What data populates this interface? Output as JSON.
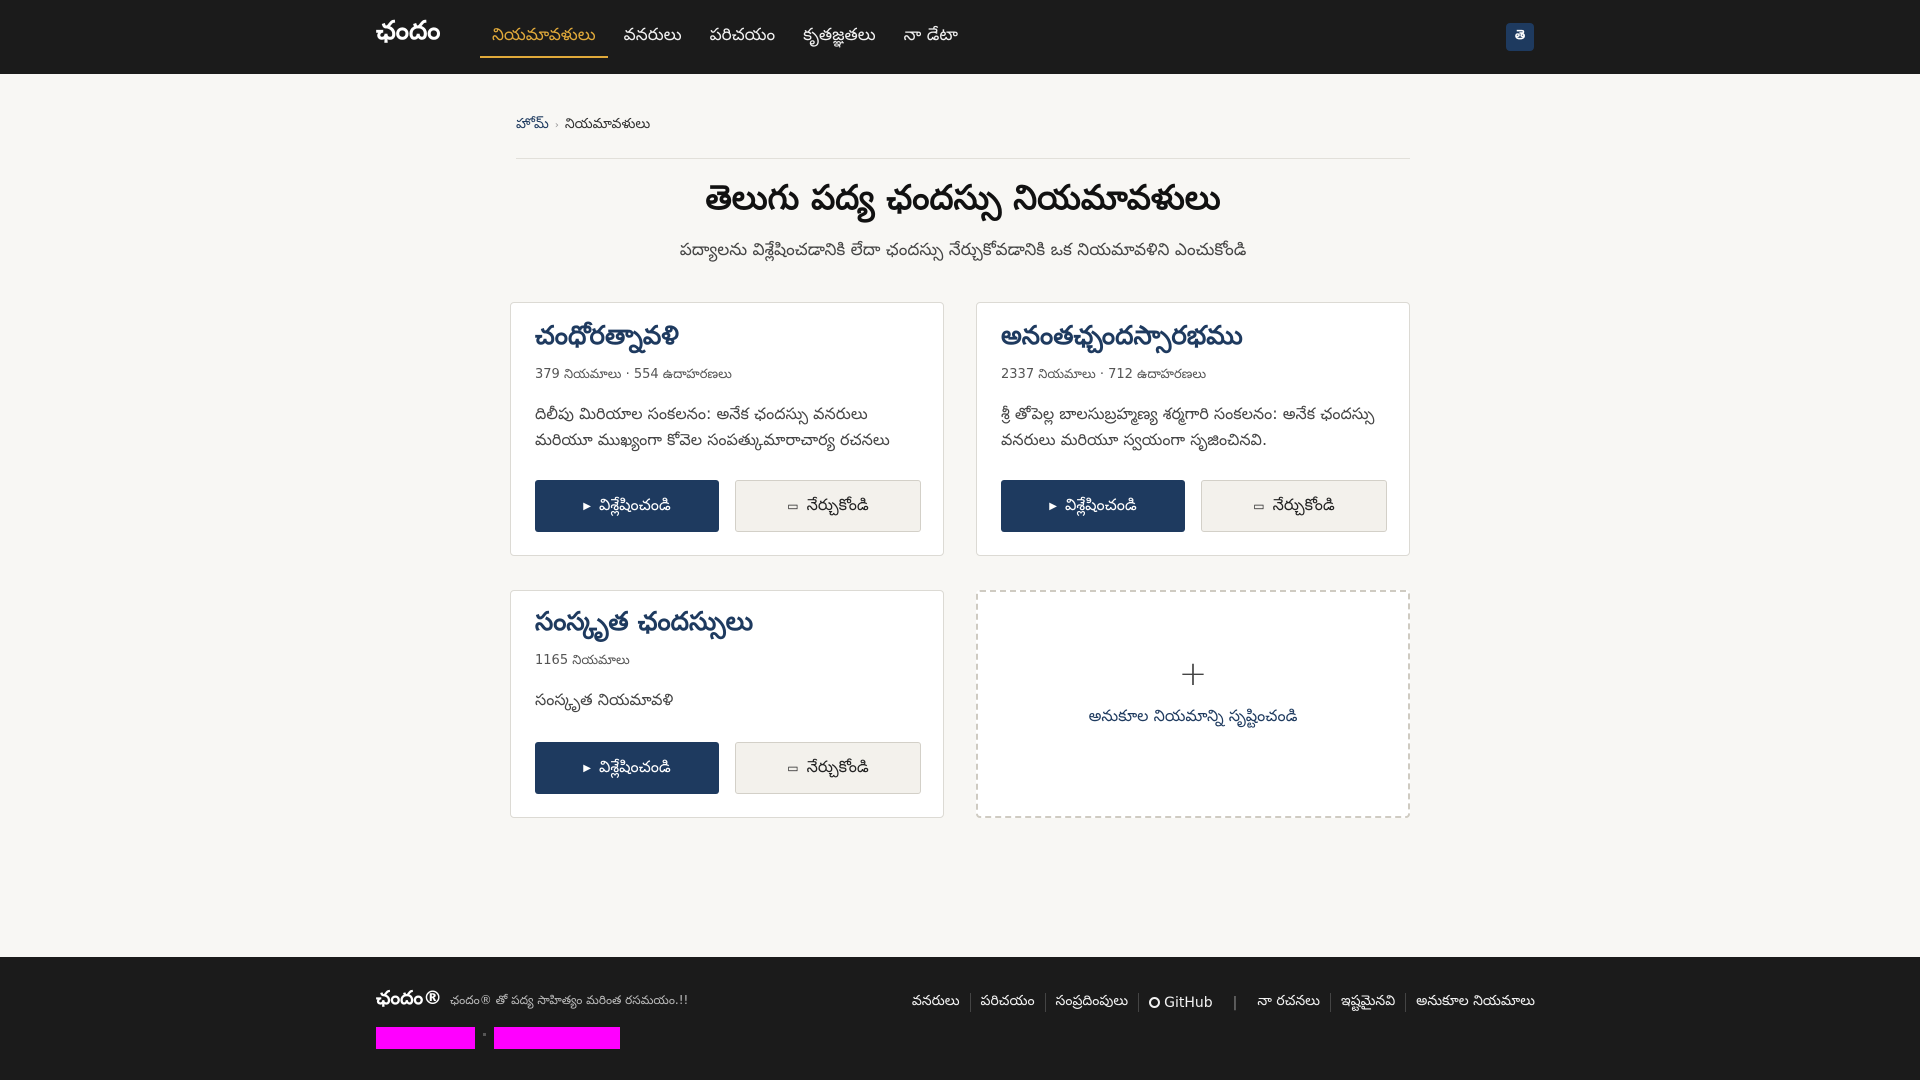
{
  "header": {
    "brand": "ఛందం",
    "nav": [
      {
        "label": "నియమావళులు",
        "active": true
      },
      {
        "label": "వనరులు"
      },
      {
        "label": "పరిచయం"
      },
      {
        "label": "కృతజ్ఞతలు"
      },
      {
        "label": "నా డేటా"
      }
    ],
    "lang_button": "తె"
  },
  "breadcrumb": {
    "home": "హోమ్",
    "current": "నియమావళులు"
  },
  "page": {
    "title": "తెలుగు పద్య ఛందస్సు నియమావళులు",
    "subtitle": "పద్యాలను విశ్లేషించడానికి లేదా ఛందస్సు నేర్చుకోవడానికి ఒక నియమావళిని ఎంచుకోండి"
  },
  "cards": [
    {
      "title": "చంధోరత్నావళి",
      "meta": "379 నియమాలు · 554 ఉదాహరణలు",
      "desc": "దిలీపు మిరియాల సంకలనం: అనేక ఛందస్సు వనరులు మరియూ ముఖ్యంగా కోవెల సంపత్కుమారాచార్య రచనలు",
      "analyze": "విశ్లేషించండి",
      "learn": "నేర్చుకోండి"
    },
    {
      "title": "అనంతఛ్చందస్సారభము",
      "meta": "2337 నియమాలు · 712 ఉదాహరణలు",
      "desc": "శ్రీ తోపెల్ల బాలసుబ్రహ్మణ్య శర్మగారి సంకలనం: అనేక ఛందస్సు వనరులు మరియూ స్వయంగా సృజించినవి.",
      "analyze": "విశ్లేషించండి",
      "learn": "నేర్చుకోండి"
    },
    {
      "title": "సంస్కృత ఛందస్సులు",
      "meta": "1165 నియమాలు",
      "desc": "సంస్కృత నియమావళి",
      "analyze": "విశ్లేషించండి",
      "learn": "నేర్చుకోండి"
    }
  ],
  "create_custom": {
    "plus": "+",
    "label": "అనుకూల నియమాన్ని సృష్టించండి"
  },
  "footer": {
    "brand": "ఛందం®",
    "tagline": "ఛందం® తో పద్య సాహిత్యం మరింత రసమయం.!!",
    "links_left": [
      "వనరులు",
      "పరిచయం",
      "సంప్రదింపులు"
    ],
    "github": "GitHub",
    "separator": "|",
    "links_right": [
      "నా రచనలు",
      "ఇష్టమైనవి",
      "అనుకూల నియమాలు"
    ]
  },
  "colors": {
    "topbar": "#1b1b1b",
    "accent": "#e0a93a",
    "primary": "#1e3a5f",
    "badge": "#ff00ff"
  }
}
